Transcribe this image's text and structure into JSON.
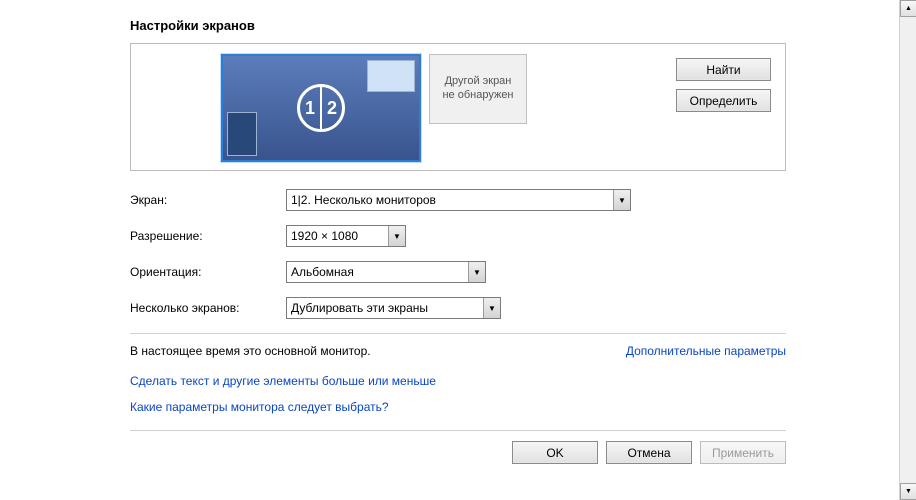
{
  "title": "Настройки экранов",
  "preview": {
    "monitor1_label": "1",
    "monitor2_label": "2",
    "gray_monitor_text": "Другой экран\nне обнаружен"
  },
  "side_buttons": {
    "find": "Найти",
    "identify": "Определить"
  },
  "form": {
    "screen_label": "Экран:",
    "screen_value": "1|2. Несколько мониторов",
    "resolution_label": "Разрешение:",
    "resolution_value": "1920 × 1080",
    "orientation_label": "Ориентация:",
    "orientation_value": "Альбомная",
    "multiscreen_label": "Несколько экранов:",
    "multiscreen_value": "Дублировать эти экраны"
  },
  "status_text": "В настоящее время это основной монитор.",
  "advanced_link": "Дополнительные параметры",
  "link_textsize": "Сделать текст и другие элементы больше или меньше",
  "link_help": "Какие параметры монитора следует выбрать?",
  "buttons": {
    "ok": "OK",
    "cancel": "Отмена",
    "apply": "Применить"
  }
}
